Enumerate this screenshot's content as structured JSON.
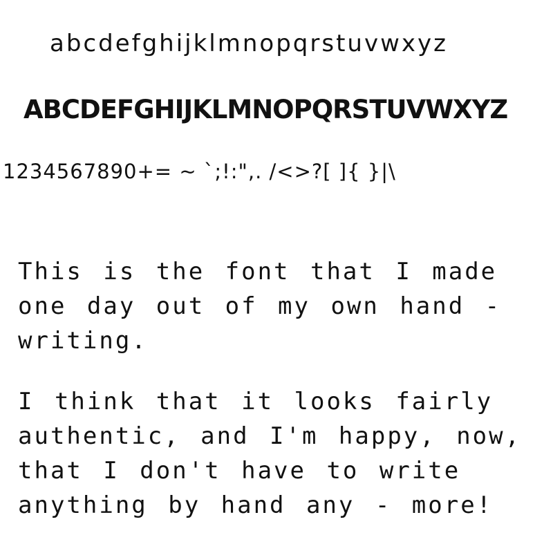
{
  "specimen": {
    "lowercase": "abcdefghijklmnopqrstuvwxyz",
    "uppercase": "ABCDEFGHIJKLMNOPQRSTUVWXYZ",
    "symbols": "1234567890+= ~ `;!:\",. /<>?[ ]{ }|\\",
    "paragraph_1": "This is the font that I made one day out of my own hand - writing.",
    "paragraph_2": "I think that it looks fairly authentic, and I'm happy, now, that I don't have to write anything by hand any - more!"
  },
  "colors": {
    "background": "#ffffff",
    "ink": "#111111"
  }
}
